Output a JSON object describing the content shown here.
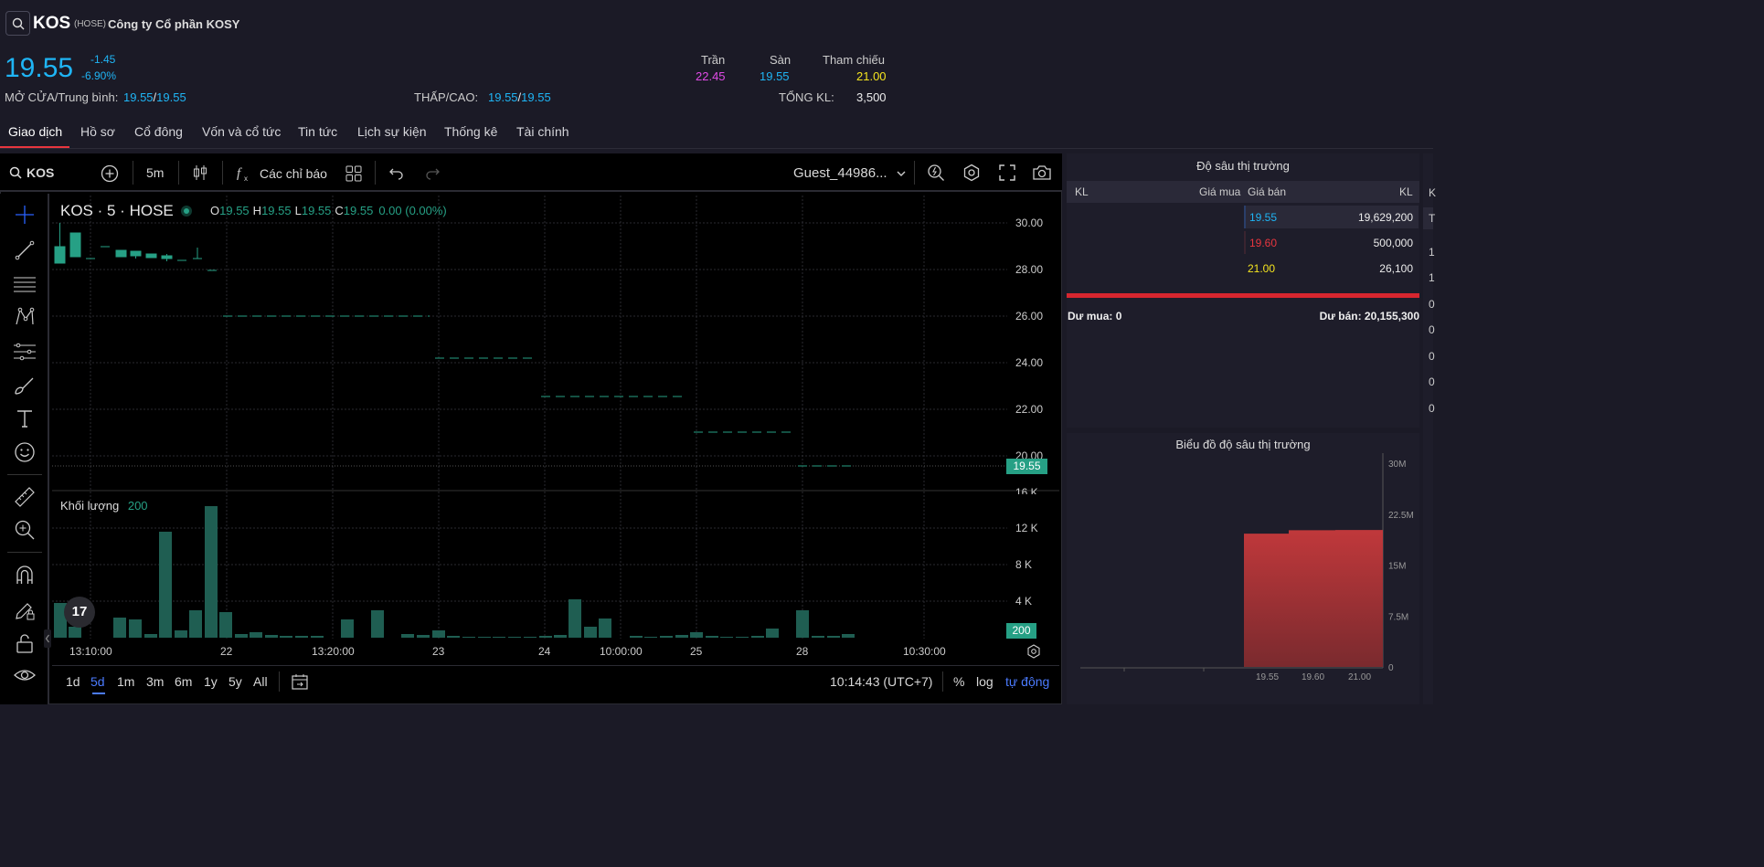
{
  "header": {
    "ticker": "KOS",
    "exchange": "(HOSE)",
    "company": "Công ty Cổ phần KOSY",
    "price": "19.55",
    "change": "-1.45",
    "change_pct": "-6.90%",
    "ceiling_label": "Trần",
    "ceiling": "22.45",
    "floor_label": "Sàn",
    "floor": "19.55",
    "ref_label": "Tham chiếu",
    "ref": "21.00",
    "open_avg_label": "MỞ CỬA/Trung bình:",
    "open": "19.55",
    "avg": "19.55",
    "low_high_label": "THẤP/CAO:",
    "low": "19.55",
    "high": "19.55",
    "total_vol_label": "TỔNG KL:",
    "total_vol": "3,500",
    "slash": "/"
  },
  "tabs": [
    "Giao dịch",
    "Hồ sơ",
    "Cổ đông",
    "Vốn và cổ tức",
    "Tin tức",
    "Lịch sự kiện",
    "Thống kê",
    "Tài chính"
  ],
  "toolbar": {
    "symbol": "KOS",
    "interval": "5m",
    "indicators": "Các chỉ báo",
    "user": "Guest_44986..."
  },
  "chart": {
    "legend_title": "KOS · 5 · HOSE",
    "o_label": "O",
    "o": "19.55",
    "h_label": "H",
    "h": "19.55",
    "l_label": "L",
    "l": "19.55",
    "c_label": "C",
    "c": "19.55",
    "chg": "0.00 (0.00%)",
    "price_axis": [
      "30.00",
      "28.00",
      "26.00",
      "24.00",
      "22.00",
      "20.00"
    ],
    "last_price_tag": "19.55",
    "volume_label": "Khối lượng",
    "volume_value": "200",
    "vol_axis": [
      "16 K",
      "12 K",
      "8 K",
      "4 K"
    ],
    "vol_tag": "200",
    "time_axis": [
      "13:10:00",
      "22",
      "13:20:00",
      "23",
      "24",
      "10:00:00",
      "25",
      "28",
      "10:30:00"
    ],
    "tv_logo": "17"
  },
  "bottom": {
    "ranges": [
      "1d",
      "5d",
      "1m",
      "3m",
      "6m",
      "1y",
      "5y",
      "All"
    ],
    "active_range": "5d",
    "clock": "10:14:43 (UTC+7)",
    "pct": "%",
    "log": "log",
    "auto": "tự động"
  },
  "depth": {
    "title": "Độ sâu thị trường",
    "col_kl": "KL",
    "col_bid": "Giá mua",
    "col_ask": "Giá bán",
    "col_kl2": "KL",
    "asks": [
      {
        "price": "19.55",
        "vol": "19,629,200",
        "color": "#1fb5f5"
      },
      {
        "price": "19.60",
        "vol": "500,000",
        "color": "#e8363f"
      },
      {
        "price": "21.00",
        "vol": "26,100",
        "color": "#f5e51f"
      }
    ],
    "surplus_buy": "Dư mua: 0",
    "surplus_sell": "Dư bán: 20,155,300"
  },
  "depth_chart": {
    "title": "Biểu đồ độ sâu thị trường",
    "y_axis": [
      "30M",
      "22.5M",
      "15M",
      "7.5M",
      "0"
    ],
    "x_axis": [
      "19.55",
      "19.60",
      "21.00"
    ],
    "chart_data": {
      "type": "area",
      "x": [
        "19.55",
        "19.60",
        "21.00"
      ],
      "series": [
        {
          "values": [
            19629200,
            20129200,
            20155300
          ]
        }
      ],
      "ylim": [
        0,
        30000000
      ]
    }
  },
  "right_strip_letters": [
    "K",
    "T",
    "1",
    "1",
    "0",
    "0",
    "0",
    "0",
    "0"
  ]
}
